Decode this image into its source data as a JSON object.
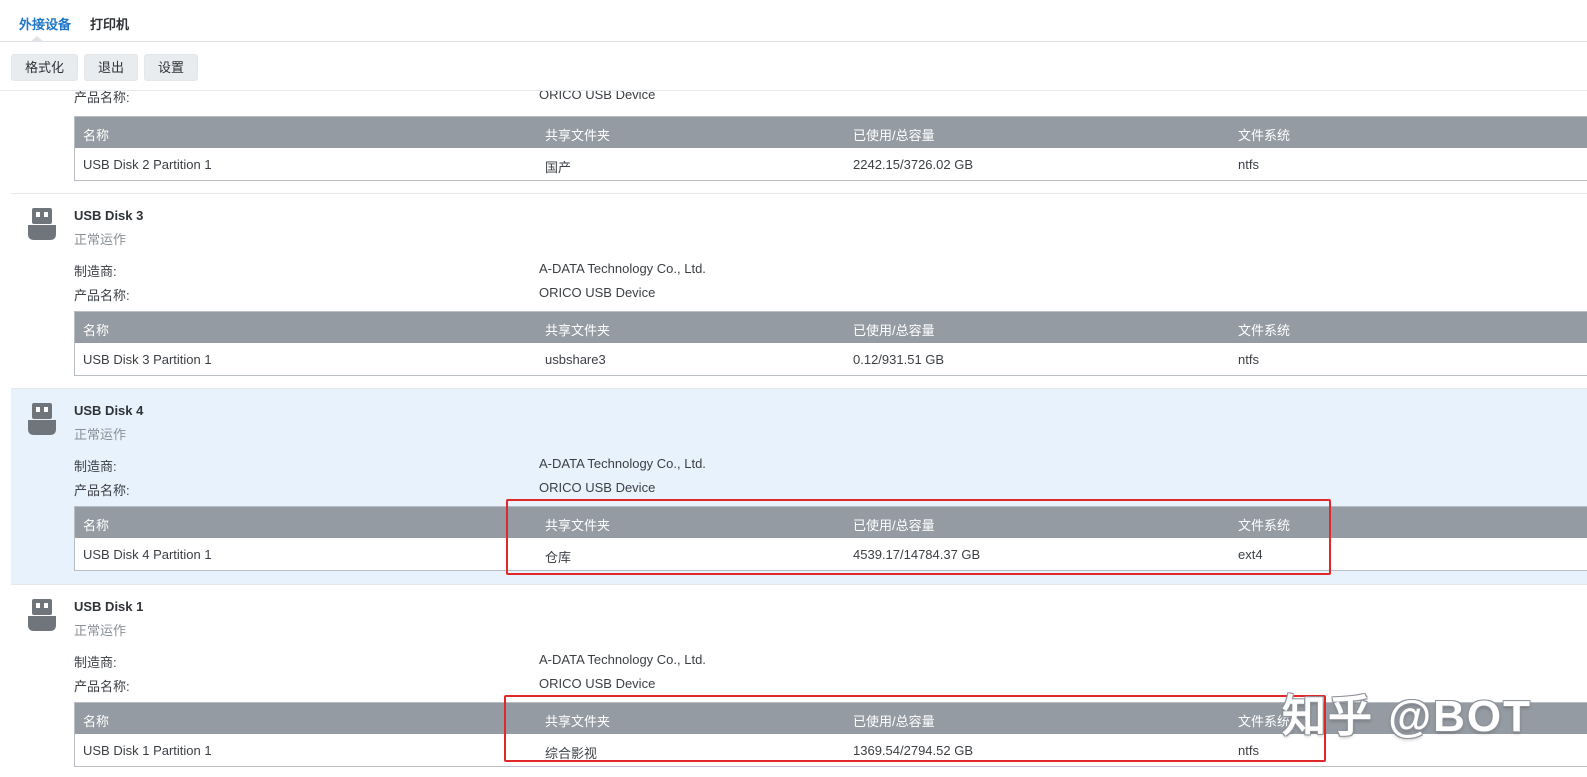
{
  "tabs": [
    {
      "label": "外接设备",
      "active": true
    },
    {
      "label": "打印机",
      "active": false
    }
  ],
  "toolbar": {
    "format_label": "格式化",
    "eject_label": "退出",
    "settings_label": "设置"
  },
  "labels": {
    "manufacturer": "制造商:",
    "product_name": "产品名称:"
  },
  "table_headers": [
    "名称",
    "共享文件夹",
    "已使用/总容量",
    "文件系统"
  ],
  "devices": [
    {
      "name": "",
      "status": "",
      "product_name": "ORICO USB Device",
      "partition": {
        "name": "USB Disk 2 Partition 1",
        "shared_folder": "国产",
        "usage": "2242.15/3726.02 GB",
        "filesystem": "ntfs"
      }
    },
    {
      "name": "USB Disk 3",
      "status": "正常运作",
      "manufacturer": "A-DATA Technology Co., Ltd.",
      "product_name": "ORICO USB Device",
      "partition": {
        "name": "USB Disk 3 Partition 1",
        "shared_folder": "usbshare3",
        "usage": "0.12/931.51 GB",
        "filesystem": "ntfs"
      }
    },
    {
      "name": "USB Disk 4",
      "status": "正常运作",
      "selected": true,
      "manufacturer": "A-DATA Technology Co., Ltd.",
      "product_name": "ORICO USB Device",
      "partition": {
        "name": "USB Disk 4 Partition 1",
        "shared_folder": "仓库",
        "usage": "4539.17/14784.37 GB",
        "filesystem": "ext4"
      }
    },
    {
      "name": "USB Disk 1",
      "status": "正常运作",
      "manufacturer": "A-DATA Technology Co., Ltd.",
      "product_name": "ORICO USB Device",
      "partition": {
        "name": "USB Disk 1 Partition 1",
        "shared_folder": "综合影视",
        "usage": "1369.54/2794.52 GB",
        "filesystem": "ntfs"
      }
    }
  ],
  "watermark": "知乎 @BOT",
  "colors": {
    "accent": "#1f77c9",
    "selected_row": "#e7f2fd",
    "table_header": "#959ba2",
    "highlight_box": "#e0282a"
  },
  "icons": {
    "device": "usb-drive-icon"
  }
}
